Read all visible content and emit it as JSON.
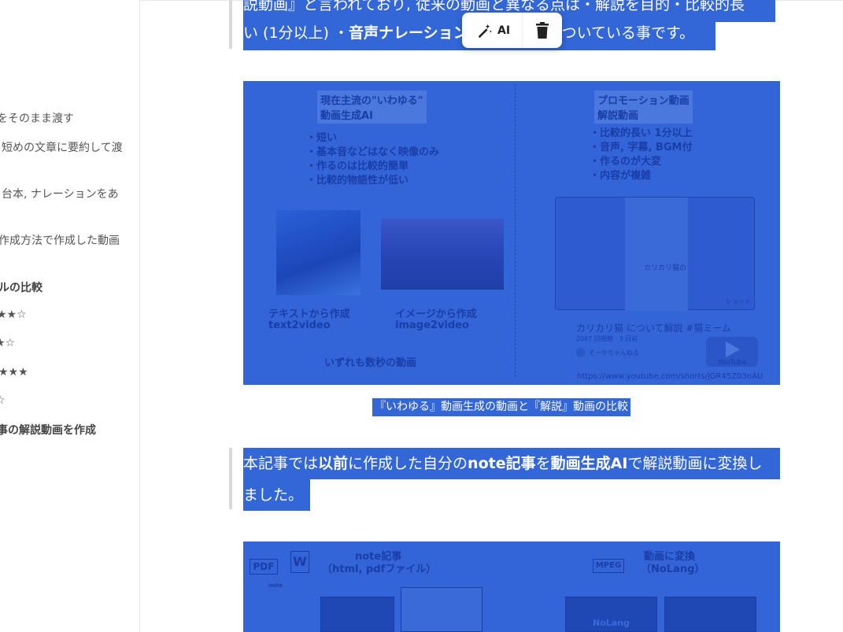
{
  "sidebar": {
    "items": [
      {
        "text": "をそのまま渡す",
        "bold": false
      },
      {
        "text": "短めの文章に要約して渡",
        "bold": false
      },
      {
        "text": "台本, ナレーションをあ",
        "bold": false
      },
      {
        "text": "作成方法で作成した動画",
        "bold": false
      },
      {
        "text": "ルの比較",
        "bold": true
      },
      {
        "text": "★★☆",
        "bold": false
      },
      {
        "text": "★☆",
        "bold": false
      },
      {
        "text": "★★★",
        "bold": false
      },
      {
        "text": "☆",
        "bold": false
      },
      {
        "text": "事の解説動画を作成",
        "bold": true
      }
    ]
  },
  "popup": {
    "ai_label": "AI",
    "ai_icon": "magic-wand-icon",
    "delete_icon": "trash-icon"
  },
  "paragraph1": {
    "line1": "説動画』と言われており, 従来の動画と異なる点は・解説を目的・比較的長",
    "line2_a": "い (1分以上) ・",
    "line2_b": "音声ナレーション",
    "line2_c": "がついている事です。"
  },
  "figure1": {
    "left_title_1": "現在主流の\"いわゆる\"",
    "left_title_2": "動画生成AI",
    "left_bullets": [
      "・短い",
      "・基本音などはなく映像のみ",
      "・作るのは比較的簡単",
      "・比較的物語性が低い"
    ],
    "label_text_1": "テキストから作成",
    "label_text_2": "text2video",
    "label_image_1": "イメージから作成",
    "label_image_2": "image2video",
    "bottom_note": "いずれも数秒の動画",
    "right_title_1": "プロモーション動画",
    "right_title_2": "解説動画",
    "right_bullets": [
      "・比較的長い 1分以上",
      "・音声, 字幕, BGM付",
      "・作るのが大変",
      "・内容が複雑"
    ],
    "yt_overlay_text": "カリカリ猫の",
    "yt_title": "カリカリ猫 について解説 #猫ミーム",
    "yt_meta": "2067 回視聴 · 3 日前",
    "yt_channel": "そーやちゃんねる",
    "yt_shorts": "ショート",
    "yt_logo": "YouTube",
    "yt_url": "https://www.youtube.com/shorts/jGR45Z03nAU"
  },
  "caption1": "『いわゆる』動画生成の動画と『解説』動画の比較",
  "paragraph2": {
    "line1_a": "本記事では",
    "line1_b": "以前",
    "line1_c": "に作成した自分の",
    "line1_d": "note記事",
    "line1_e": "を",
    "line1_f": "動画生成AI",
    "line1_g": "で解説動画に変換し",
    "line2": "ました。"
  },
  "figure2": {
    "pdf_label": "PDF",
    "word_label": "W",
    "note_label": "note",
    "left_title_1": "note記事",
    "left_title_2": "（html, pdfファイル）",
    "mpeg_label": "MPEG",
    "right_title_1": "動画に変換",
    "right_title_2": "（NoLang）",
    "nolang_label": "NoLang"
  }
}
